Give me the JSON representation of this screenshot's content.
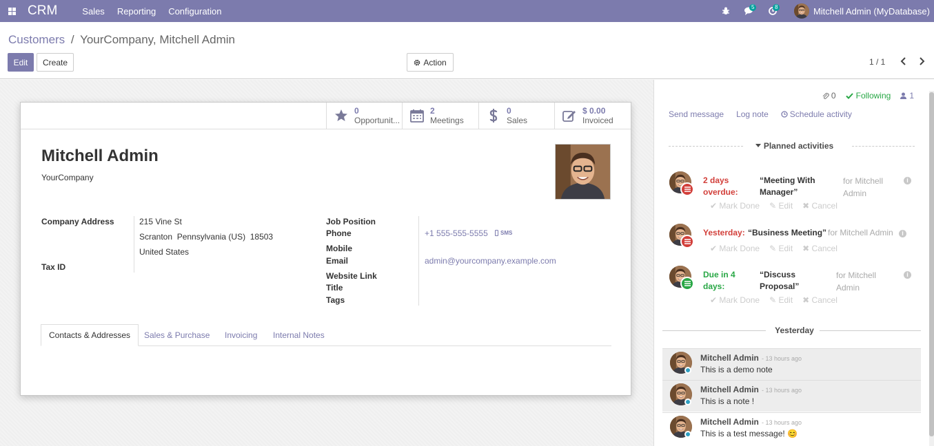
{
  "topbar": {
    "app_name": "CRM",
    "menu": [
      "Sales",
      "Reporting",
      "Configuration"
    ],
    "badges": {
      "messages": "5",
      "activities": "8"
    },
    "user": "Mitchell Admin (MyDatabase)",
    "color": "#7c7bad"
  },
  "control_panel": {
    "breadcrumb_parent": "Customers",
    "breadcrumb_sep": "/",
    "breadcrumb_current": "YourCompany, Mitchell Admin",
    "edit_label": "Edit",
    "create_label": "Create",
    "action_label": "Action",
    "pager": "1 / 1"
  },
  "stats": [
    {
      "value": "0",
      "label": "Opportunit...",
      "icon": "star-icon"
    },
    {
      "value": "2",
      "label": "Meetings",
      "icon": "calendar-icon"
    },
    {
      "value": "0",
      "label": "Sales",
      "icon": "dollar-icon"
    },
    {
      "value": "$ 0.00",
      "label": "Invoiced",
      "icon": "edit-icon"
    }
  ],
  "partner": {
    "name": "Mitchell Admin",
    "company": "YourCompany",
    "company_address_label": "Company Address",
    "street": "215 Vine St",
    "city_line": "Scranton  Pennsylvania (US)  18503",
    "country": "United States",
    "tax_id_label": "Tax ID",
    "job_position_label": "Job Position",
    "phone_label": "Phone",
    "phone": "+1 555-555-5555",
    "sms_label": "SMS",
    "mobile_label": "Mobile",
    "email_label": "Email",
    "email": "admin@yourcompany.example.com",
    "website_label": "Website Link",
    "title_label": "Title",
    "tags_label": "Tags"
  },
  "tabs": [
    "Contacts & Addresses",
    "Sales & Purchase",
    "Invoicing",
    "Internal Notes"
  ],
  "chatter": {
    "attachments": "0",
    "following": "Following",
    "followers": "1",
    "send_message": "Send message",
    "log_note": "Log note",
    "schedule_activity": "Schedule activity",
    "planned_title": "Planned activities",
    "activities": [
      {
        "due_l1": "2 days",
        "due_l2": "overdue:",
        "due_color": "#d23f3a",
        "summary_l1": "“Meeting With",
        "summary_l2": "Manager”",
        "for_l1": "for Mitchell",
        "for_l2": "Admin",
        "icon_color": "#d23f3a"
      },
      {
        "due_l1": "Yesterday:",
        "due_l2": "",
        "due_color": "#d23f3a",
        "summary_l1": "“Business Meeting”",
        "summary_l2": "",
        "for_l1": "for Mitchell Admin",
        "for_l2": "",
        "icon_color": "#d23f3a"
      },
      {
        "due_l1": "Due in 4",
        "due_l2": "days:",
        "due_color": "#28a745",
        "summary_l1": "“Discuss",
        "summary_l2": "Proposal”",
        "for_l1": "for Mitchell",
        "for_l2": "Admin",
        "icon_color": "#28a745"
      }
    ],
    "ops": {
      "done": "Mark Done",
      "edit": "Edit",
      "cancel": "Cancel"
    },
    "day_separator": "Yesterday",
    "messages": [
      {
        "author": "Mitchell Admin",
        "time": "- 13 hours ago",
        "body": "This is a demo note"
      },
      {
        "author": "Mitchell Admin",
        "time": "- 13 hours ago",
        "body": "This is a note !"
      },
      {
        "author": "Mitchell Admin",
        "time": "- 13 hours ago",
        "body": "This is a test message! 😊"
      }
    ]
  }
}
